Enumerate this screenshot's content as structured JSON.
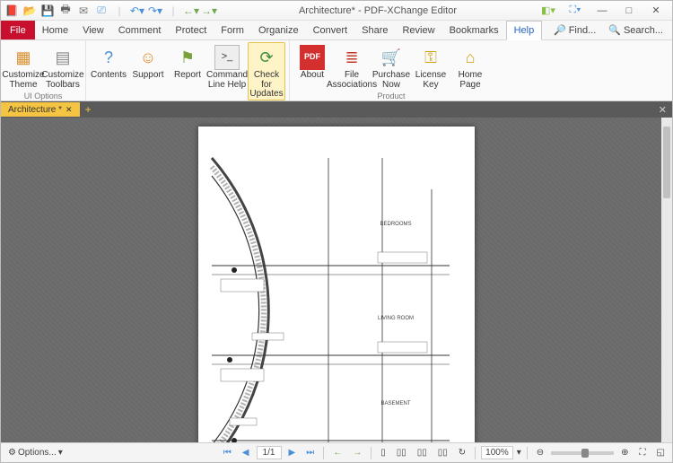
{
  "title": "Architecture* - PDF-XChange Editor",
  "menu": {
    "file": "File",
    "tabs": [
      "Home",
      "View",
      "Comment",
      "Protect",
      "Form",
      "Organize",
      "Convert",
      "Share",
      "Review",
      "Bookmarks",
      "Help"
    ],
    "active": "Help",
    "find": "Find...",
    "search": "Search..."
  },
  "ribbon": {
    "groups": [
      {
        "label": "UI Options",
        "items": [
          {
            "name": "customize-theme",
            "label": "Customize Theme",
            "icon": "▦"
          },
          {
            "name": "customize-toolbars",
            "label": "Customize Toolbars",
            "icon": "▤"
          }
        ]
      },
      {
        "label": "Help",
        "items": [
          {
            "name": "contents",
            "label": "Contents",
            "icon": "?"
          },
          {
            "name": "support",
            "label": "Support",
            "icon": "☺"
          },
          {
            "name": "report",
            "label": "Report",
            "icon": "⚑"
          },
          {
            "name": "command-line-help",
            "label": "Command Line Help",
            "icon": ">_"
          },
          {
            "name": "check-for-updates",
            "label": "Check for Updates",
            "icon": "⟳",
            "highlight": true
          }
        ]
      },
      {
        "label": "Product",
        "items": [
          {
            "name": "about",
            "label": "About",
            "icon": "PDF"
          },
          {
            "name": "file-associations",
            "label": "File Associations",
            "icon": "≣"
          },
          {
            "name": "purchase-now",
            "label": "Purchase Now",
            "icon": "🛒"
          },
          {
            "name": "license-key",
            "label": "License Key",
            "icon": "⚿"
          },
          {
            "name": "home-page",
            "label": "Home Page",
            "icon": "⌂"
          }
        ]
      }
    ]
  },
  "doc_tab": {
    "name": "Architecture *"
  },
  "drawing": {
    "rooms": [
      "BEDROOMS",
      "LIVING ROOM",
      "BASEMENT"
    ]
  },
  "status": {
    "options": "Options...",
    "page_current": "1",
    "page_sep": "/",
    "page_total": "1",
    "zoom": "100%"
  }
}
